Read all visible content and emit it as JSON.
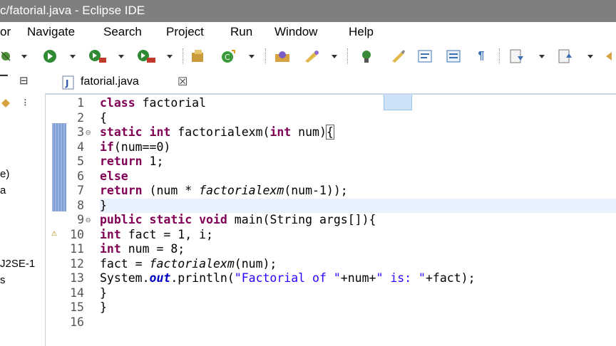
{
  "window": {
    "title": "c/fatorial.java - Eclipse IDE"
  },
  "menu": [
    "or",
    "Navigate",
    "Search",
    "Project",
    "Run",
    "Window",
    "Help"
  ],
  "left_panel": {
    "lines": [
      "e)",
      "a",
      "J2SE-1",
      "s"
    ]
  },
  "editor": {
    "tab_label": "fatorial.java",
    "tab_close": "☒",
    "current_line": 8,
    "lines": [
      {
        "n": "1",
        "segments": [
          {
            "t": "class",
            "k": "kw"
          },
          {
            "t": " factorial"
          }
        ]
      },
      {
        "n": "2",
        "segments": [
          {
            "t": "{"
          }
        ]
      },
      {
        "n": "3",
        "fold": "⊖",
        "segments": [
          {
            "t": "static",
            "k": "kw"
          },
          {
            "t": " "
          },
          {
            "t": "int",
            "k": "kw"
          },
          {
            "t": " factorialexm("
          },
          {
            "t": "int",
            "k": "kw"
          },
          {
            "t": " num)"
          },
          {
            "t": "{",
            "k": "box"
          }
        ]
      },
      {
        "n": "4",
        "segments": [
          {
            "t": "if",
            "k": "kw"
          },
          {
            "t": "(num==0)"
          }
        ]
      },
      {
        "n": "5",
        "segments": [
          {
            "t": "return",
            "k": "kw"
          },
          {
            "t": " 1;"
          }
        ]
      },
      {
        "n": "6",
        "segments": [
          {
            "t": "else",
            "k": "kw"
          }
        ]
      },
      {
        "n": "7",
        "segments": [
          {
            "t": "return",
            "k": "kw"
          },
          {
            "t": " (num * "
          },
          {
            "t": "factorialexm",
            "k": "it"
          },
          {
            "t": "(num-1));"
          }
        ]
      },
      {
        "n": "8",
        "segments": [
          {
            "t": "}"
          }
        ]
      },
      {
        "n": "9",
        "fold": "⊖",
        "segments": [
          {
            "t": "public",
            "k": "kw"
          },
          {
            "t": " "
          },
          {
            "t": "static",
            "k": "kw"
          },
          {
            "t": " "
          },
          {
            "t": "void",
            "k": "kw"
          },
          {
            "t": " main(String args[]){"
          }
        ]
      },
      {
        "n": "10",
        "warn": true,
        "segments": [
          {
            "t": "int",
            "k": "kw"
          },
          {
            "t": " fact = 1, i;"
          }
        ]
      },
      {
        "n": "11",
        "segments": [
          {
            "t": "int",
            "k": "kw"
          },
          {
            "t": " num = 8;"
          }
        ]
      },
      {
        "n": "12",
        "segments": [
          {
            "t": "fact = "
          },
          {
            "t": "factorialexm",
            "k": "it"
          },
          {
            "t": "(num);"
          }
        ]
      },
      {
        "n": "13",
        "segments": [
          {
            "t": "System."
          },
          {
            "t": "out",
            "k": "fld"
          },
          {
            "t": ".println("
          },
          {
            "t": "\"Factorial of \"",
            "k": "str"
          },
          {
            "t": "+num+"
          },
          {
            "t": "\" is: \"",
            "k": "str"
          },
          {
            "t": "+fact);"
          }
        ]
      },
      {
        "n": "14",
        "segments": [
          {
            "t": "}"
          }
        ]
      },
      {
        "n": "15",
        "segments": [
          {
            "t": "}"
          }
        ]
      },
      {
        "n": "16",
        "segments": []
      }
    ]
  },
  "colors": {
    "keyword": "#7f0055",
    "string": "#2a00ff",
    "field": "#0000c0",
    "titlebar": "#7f7f7f"
  }
}
